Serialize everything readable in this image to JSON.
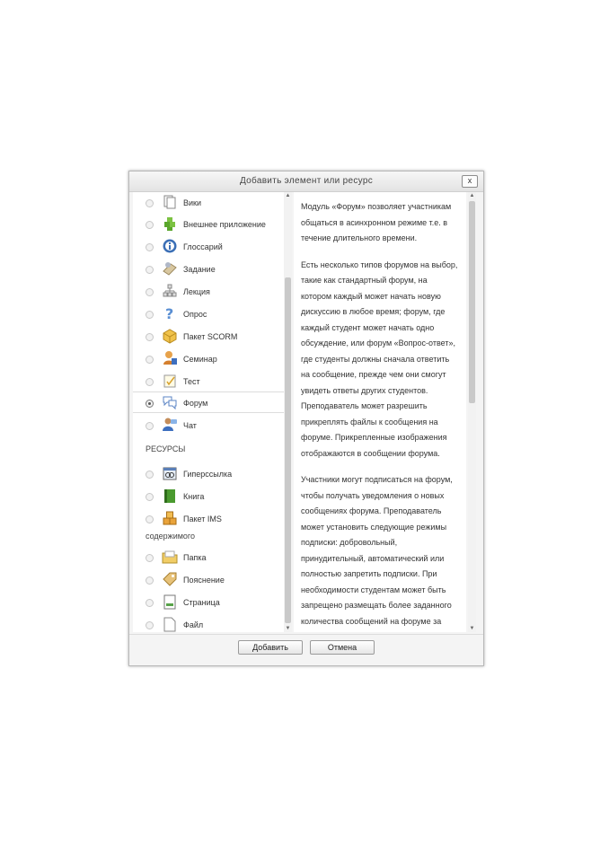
{
  "dialog": {
    "title": "Добавить элемент или ресурс",
    "close_label": "x"
  },
  "activities": [
    {
      "label": "Вики",
      "icon": "wiki-icon",
      "selected": false
    },
    {
      "label": "Внешнее приложение",
      "icon": "puzzle-icon",
      "selected": false
    },
    {
      "label": "Глоссарий",
      "icon": "info-icon",
      "selected": false
    },
    {
      "label": "Задание",
      "icon": "assignment-icon",
      "selected": false
    },
    {
      "label": "Лекция",
      "icon": "lesson-icon",
      "selected": false
    },
    {
      "label": "Опрос",
      "icon": "question-icon",
      "selected": false
    },
    {
      "label": "Пакет SCORM",
      "icon": "package-icon",
      "selected": false
    },
    {
      "label": "Семинар",
      "icon": "workshop-icon",
      "selected": false
    },
    {
      "label": "Тест",
      "icon": "quiz-icon",
      "selected": false
    },
    {
      "label": "Форум",
      "icon": "forum-icon",
      "selected": true
    },
    {
      "label": "Чат",
      "icon": "chat-icon",
      "selected": false
    }
  ],
  "resources_header": "РЕСУРСЫ",
  "resources": [
    {
      "label": "Гиперссылка",
      "icon": "url-icon"
    },
    {
      "label": "Книга",
      "icon": "book-icon"
    },
    {
      "label": "Пакет IMS",
      "icon": "ims-package-icon"
    }
  ],
  "content_header": "содержимого",
  "content": [
    {
      "label": "Папка",
      "icon": "folder-icon"
    },
    {
      "label": "Пояснение",
      "icon": "label-icon"
    },
    {
      "label": "Страница",
      "icon": "page-icon"
    },
    {
      "label": "Файл",
      "icon": "file-icon"
    }
  ],
  "description": [
    "Модуль «Форум» позволяет участникам общаться в асинхронном режиме т.е. в течение длительного времени.",
    "Есть несколько типов форумов на выбор, такие как стандартный форум, на котором каждый может начать новую дискуссию в любое время; форум, где каждый студент может начать одно обсуждение, или форум «Вопрос-ответ», где студенты должны сначала ответить на сообщение, прежде чем они смогут увидеть ответы других студентов. Преподаватель может разрешить прикреплять файлы к сообщения на форуме. Прикрепленные изображения отображаются в сообщении форума.",
    "Участники могут подписаться на форум, чтобы получать уведомления о новых сообщениях форума. Преподаватель может установить следующие режимы подписки: добровольный, принудительный, автоматический или полностью запретить подписки. При необходимости студентам может быть запрещено размещать более заданного количества сообщений на форуме за определенный период времени."
  ],
  "buttons": {
    "add": "Добавить",
    "cancel": "Отмена"
  }
}
